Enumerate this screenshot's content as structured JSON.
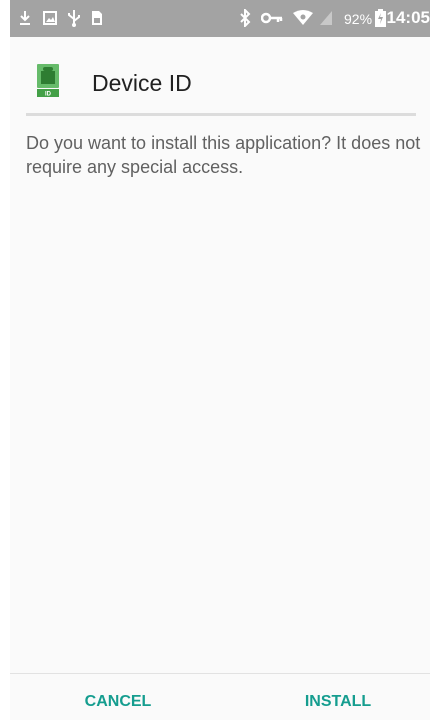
{
  "status_bar": {
    "battery_percent": "92%",
    "time": "14:05",
    "left_icons": [
      "download-icon",
      "image-icon",
      "usb-icon",
      "sim-icon"
    ],
    "right_icons": [
      "bluetooth-icon",
      "vpn-key-icon",
      "wifi-icon",
      "signal-icon",
      "battery-charging-icon"
    ]
  },
  "app": {
    "name": "Device ID",
    "icon": "device-id-app-icon",
    "icon_badge": "ID",
    "icon_color": "#4caf50"
  },
  "dialog": {
    "message": "Do you want to install this application? It does not require any special access."
  },
  "actions": {
    "cancel_label": "CANCEL",
    "install_label": "INSTALL",
    "accent_color": "#159d8f"
  }
}
